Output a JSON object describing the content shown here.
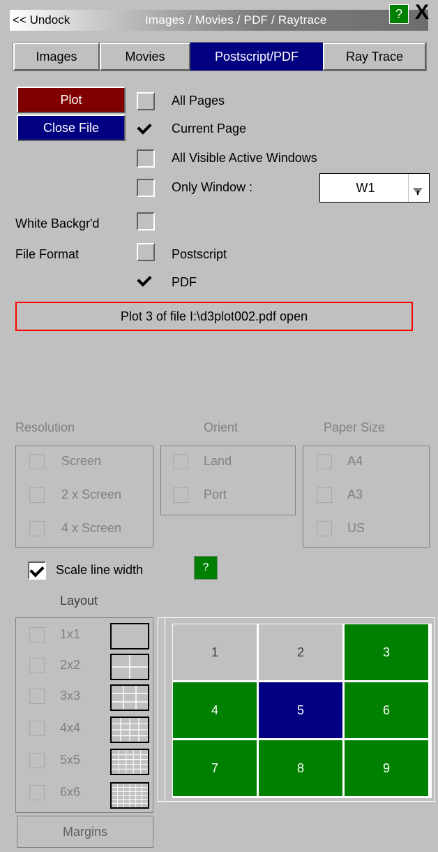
{
  "titlebar": {
    "undock": "<< Undock",
    "title": "Images / Movies / PDF / Raytrace",
    "help": "?",
    "close": "X"
  },
  "tabs": [
    "Images",
    "Movies",
    "Postscript/PDF",
    "Ray Trace"
  ],
  "active_tab": "Postscript/PDF",
  "actions": {
    "plot": "Plot",
    "close_file": "Close File"
  },
  "page_options": {
    "all_pages": "All Pages",
    "current_page": "Current Page",
    "all_visible": "All Visible Active Windows",
    "only_window": "Only Window :",
    "window_value": "W1"
  },
  "white_backgrd": "White Backgr'd",
  "file_format": {
    "label": "File Format",
    "postscript": "Postscript",
    "pdf": "PDF"
  },
  "status": "Plot  3 of file I:\\d3plot002.pdf open",
  "resolution": {
    "label": "Resolution",
    "options": [
      "Screen",
      "2 x Screen",
      "4 x Screen"
    ]
  },
  "orient": {
    "label": "Orient",
    "options": [
      "Land",
      "Port"
    ]
  },
  "paper": {
    "label": "Paper Size",
    "options": [
      "A4",
      "A3",
      "US"
    ]
  },
  "scale_line_width": "Scale line width",
  "help_small": "?",
  "layout": {
    "label": "Layout",
    "options": [
      "1x1",
      "2x2",
      "3x3",
      "4x4",
      "5x5",
      "6x6"
    ]
  },
  "grid": [
    "1",
    "2",
    "3",
    "4",
    "5",
    "6",
    "7",
    "8",
    "9"
  ],
  "colors": {
    "active_tab": "#000080",
    "plot": "#800000",
    "close_file": "#000080",
    "green": "#008000",
    "status_border": "#ff0000"
  },
  "margins": "Margins"
}
